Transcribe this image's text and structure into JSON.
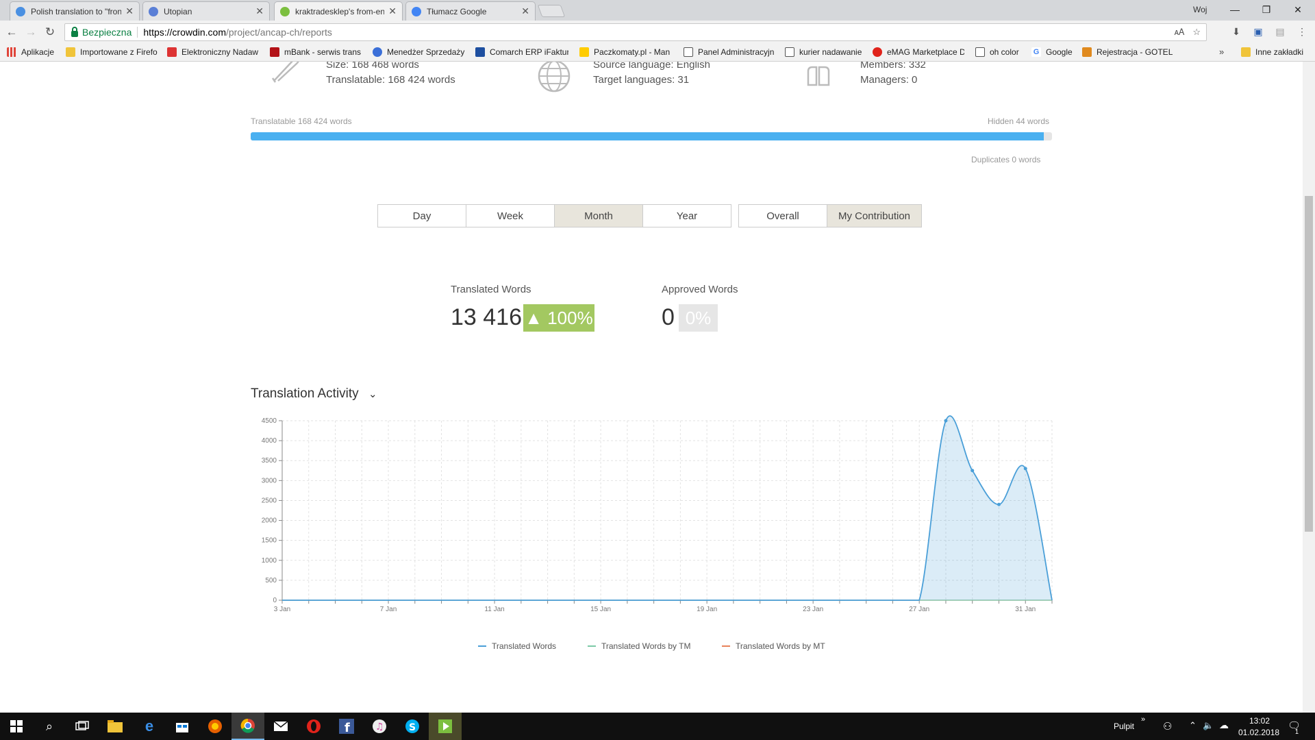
{
  "browser": {
    "tabs": [
      {
        "title": "Polish translation to \"fron",
        "favicon_color": "#4a90e2"
      },
      {
        "title": "Utopian",
        "favicon_color": "#5a7fd6"
      },
      {
        "title": "kraktradesklep's from-en",
        "favicon_color": "#7cbf3f"
      },
      {
        "title": "Tłumacz Google",
        "favicon_color": "#4285f4"
      }
    ],
    "user": "Woj",
    "secure_label": "Bezpieczna",
    "url_host": "https://crowdin.com",
    "url_path": "/project/ancap-ch/reports",
    "bookmarks": [
      {
        "label": "Aplikacje",
        "color": "#e0453a"
      },
      {
        "label": "Importowane z Firefo",
        "color": "#f0c43a"
      },
      {
        "label": "Elektroniczny Nadaw",
        "color": "#d33"
      },
      {
        "label": "mBank - serwis trans",
        "color": "#b31217"
      },
      {
        "label": "Menedżer Sprzedaży",
        "color": "#3b6fd8"
      },
      {
        "label": "Comarch ERP iFaktur",
        "color": "#1e4fa0"
      },
      {
        "label": "Paczkomaty.pl - Man",
        "color": "#ffcc00"
      },
      {
        "label": "Panel Administracyjn",
        "color": "#ffffff"
      },
      {
        "label": "kurier nadawanie",
        "color": "#ffffff"
      },
      {
        "label": "eMAG Marketplace D",
        "color": "#e0231b"
      },
      {
        "label": "oh color",
        "color": "#ffffff"
      },
      {
        "label": "Google",
        "color": "#4285f4"
      },
      {
        "label": "Rejestracja - GOTEL I",
        "color": "#e08a1e"
      }
    ],
    "other_bookmarks": "Inne zakładki"
  },
  "stats": {
    "size": "Size: 168 468 words",
    "translatable": "Translatable: 168 424 words",
    "source_language": "Source language: English",
    "target_languages": "Target languages: 31",
    "members": "Members: 332",
    "managers": "Managers: 0"
  },
  "progress": {
    "left_label": "Translatable 168 424 words",
    "right_label": "Hidden 44 words",
    "duplicates_label": "Duplicates 0 words",
    "fill_fraction": 0.9897
  },
  "period_buttons": [
    "Day",
    "Week",
    "Month",
    "Year"
  ],
  "period_selected": "Month",
  "scope_buttons": [
    "Overall",
    "My Contribution"
  ],
  "scope_selected": "My Contribution",
  "metrics": {
    "translated_label": "Translated Words",
    "translated_value": "13 416",
    "translated_change": "▲ 100%",
    "approved_label": "Approved Words",
    "approved_value": "0",
    "approved_change": "0%",
    "positive_color": "#a3c861",
    "neutral_color": "#e6e6e6"
  },
  "activity_title": "Translation Activity",
  "chart_data": {
    "type": "area",
    "x": [
      "3 Jan",
      "4 Jan",
      "5 Jan",
      "6 Jan",
      "7 Jan",
      "8 Jan",
      "9 Jan",
      "10 Jan",
      "11 Jan",
      "12 Jan",
      "13 Jan",
      "14 Jan",
      "15 Jan",
      "16 Jan",
      "17 Jan",
      "18 Jan",
      "19 Jan",
      "20 Jan",
      "21 Jan",
      "22 Jan",
      "23 Jan",
      "24 Jan",
      "25 Jan",
      "26 Jan",
      "27 Jan",
      "28 Jan",
      "29 Jan",
      "30 Jan",
      "31 Jan",
      "1 Feb"
    ],
    "x_tick_labels": [
      "3 Jan",
      "7 Jan",
      "11 Jan",
      "15 Jan",
      "19 Jan",
      "23 Jan",
      "27 Jan",
      "31 Jan"
    ],
    "ylim": [
      0,
      4500
    ],
    "y_ticks": [
      0,
      500,
      1000,
      1500,
      2000,
      2500,
      3000,
      3500,
      4000,
      4500
    ],
    "series": [
      {
        "name": "Translated Words",
        "color": "#4a9fd8",
        "values": [
          0,
          0,
          0,
          0,
          0,
          0,
          0,
          0,
          0,
          0,
          0,
          0,
          0,
          0,
          0,
          0,
          0,
          0,
          0,
          0,
          0,
          0,
          0,
          0,
          0,
          4500,
          3250,
          2400,
          3300,
          0
        ]
      },
      {
        "name": "Translated Words by TM",
        "color": "#7bc9a6",
        "values": [
          0,
          0,
          0,
          0,
          0,
          0,
          0,
          0,
          0,
          0,
          0,
          0,
          0,
          0,
          0,
          0,
          0,
          0,
          0,
          0,
          0,
          0,
          0,
          0,
          0,
          0,
          0,
          0,
          0,
          0
        ]
      },
      {
        "name": "Translated Words by MT",
        "color": "#e8825a",
        "values": [
          0,
          0,
          0,
          0,
          0,
          0,
          0,
          0,
          0,
          0,
          0,
          0,
          0,
          0,
          0,
          0,
          0,
          0,
          0,
          0,
          0,
          0,
          0,
          0,
          0,
          0,
          0,
          0,
          0,
          0
        ]
      }
    ],
    "grid": true,
    "legend_position": "bottom"
  },
  "taskbar": {
    "desktop_label": "Pulpit",
    "time": "13:02",
    "date": "01.02.2018",
    "notification_count": "1"
  }
}
